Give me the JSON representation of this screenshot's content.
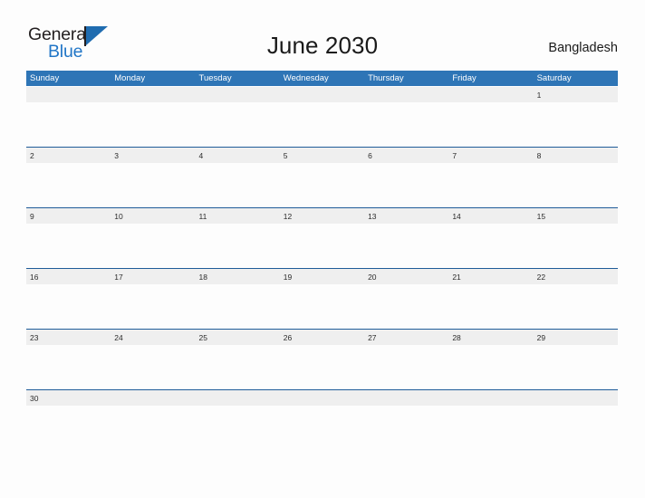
{
  "brand": {
    "word_one": "General",
    "word_two": "Blue",
    "flag_icon": "flag-triangle-icon",
    "accent_color": "#2176c7"
  },
  "header": {
    "title": "June 2030",
    "country": "Bangladesh"
  },
  "calendar": {
    "header_color": "#2e75b6",
    "rule_color": "#1f5c99",
    "date_band_color": "#efefef",
    "day_names": [
      "Sunday",
      "Monday",
      "Tuesday",
      "Wednesday",
      "Thursday",
      "Friday",
      "Saturday"
    ],
    "weeks": [
      [
        "",
        "",
        "",
        "",
        "",
        "",
        "1"
      ],
      [
        "2",
        "3",
        "4",
        "5",
        "6",
        "7",
        "8"
      ],
      [
        "9",
        "10",
        "11",
        "12",
        "13",
        "14",
        "15"
      ],
      [
        "16",
        "17",
        "18",
        "19",
        "20",
        "21",
        "22"
      ],
      [
        "23",
        "24",
        "25",
        "26",
        "27",
        "28",
        "29"
      ],
      [
        "30",
        "",
        "",
        "",
        "",
        "",
        ""
      ]
    ]
  }
}
